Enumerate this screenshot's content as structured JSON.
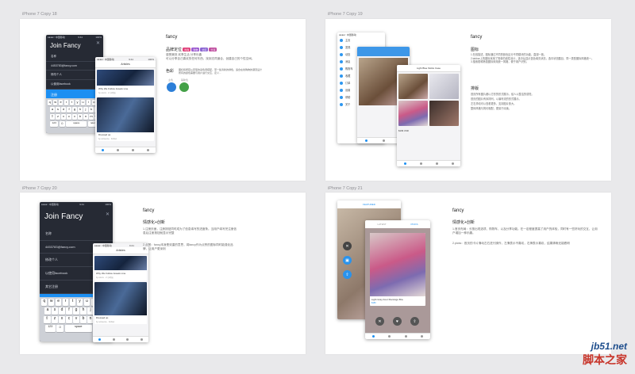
{
  "artboards": [
    {
      "title": "iPhone 7 Copy 18"
    },
    {
      "title": "iPhone 7 Copy 19"
    },
    {
      "title": "iPhone 7 Copy 20"
    },
    {
      "title": "iPhone 7 Copy 21"
    }
  ],
  "phone_status": {
    "carrier": "●●●●○ 中国移动",
    "time": "9:41",
    "battery": "100%"
  },
  "join_fancy": {
    "title": "Join Fancy",
    "row1": "名称",
    "row2": "4453783@fancy.com",
    "row3": "修改个人",
    "row4": "以使用facebook",
    "row5": "其它注册",
    "blue_bar": "注册"
  },
  "keyboard": {
    "row1": [
      "q",
      "w",
      "e",
      "r",
      "t",
      "y",
      "u",
      "i",
      "o",
      "p"
    ],
    "row2": [
      "a",
      "s",
      "d",
      "f",
      "g",
      "h",
      "j",
      "k",
      "l"
    ],
    "row3": [
      "⇧",
      "z",
      "x",
      "c",
      "v",
      "b",
      "n",
      "m",
      "⌫"
    ],
    "row4": [
      "123",
      "☺",
      "space",
      "return"
    ]
  },
  "articles": {
    "header": "Articles",
    "card1_title": "Why We Follow Jewels Line",
    "card1_sub": "by ooxxx · 2 小时前",
    "card2_title": "Dressed up",
    "card2_sub": "by someone · Follow"
  },
  "section1": {
    "heading": "fancy",
    "brand_label": "品牌定位",
    "tags": [
      "时尚",
      "购物",
      "社区",
      "分享"
    ],
    "brand_text": "感受潮流 欢享生活 分享乐趣\n可以分享自己喜欢的任何东西，找到志同道合，创建自己的个性空间。",
    "color_label": "色彩",
    "color_text": "图标和按钮从原型的蓝色调搭配，带一些清新的绿色，适合在线购物的潮流设计\n所有的颜色需要与用户进行交互、定义...",
    "swatch1_label": "主色",
    "swatch2_label": "辅助色",
    "swatch1": "#2c7fd8",
    "swatch2": "#43a047"
  },
  "section2": {
    "heading": "fancy",
    "icon_title": "图标",
    "icon_text1": "1.在线描述，图标通过不同的颜色区分不同模块的功能，直观一致。",
    "icon_text2": "2.tabbar上的图标采用了简单的线性设计，选中后显示蓝色填充状态，选中状态醒目，同一类型图标风格统一。",
    "icon_text3": "3.搜索框和筛选图标采用统一风格，便于用户识别。",
    "layout_title": "排版",
    "layout_text1": "首页所有图片都以方形的形式展示，给人以整洁的感觉。",
    "layout_text2": "首页的图片有序排列，以瀑布流的形式展示。",
    "layout_text3": "左右滑动可以查看更多，支持图片放大。",
    "layout_text4": "整体风格与简约相配，更易于阅读。",
    "menu_items": [
      "主页",
      "发现",
      "动态",
      "消息",
      "购物车",
      "收藏",
      "订单",
      "设置",
      "帮助",
      "关于"
    ],
    "tile_caption": "Light Blue Sticks Case",
    "price_tag": "$109 USD"
  },
  "section3": {
    "heading": "fancy",
    "title": "情感化+创新",
    "text1": "1.注册页面，注册按钮同时成为了信息填写的进度条。当用户填写完注册信息后注册按钮就显示完整",
    "text2": "2.点赞：fancy本身是双重的意思，将fancy作为点赞的图标同时能强化品牌，让用户更深刻"
  },
  "section4": {
    "heading": "fancy",
    "title": "情感化+创新",
    "text1": "1.首页布局：长按出现选项、购物车、以及分享功能。在一定程度提高了用户的体验，同时有一些好玩的交互，让用户增加一种乐趣。",
    "text2": "2.picks：首页的卡片滑动左右进行操作，左滑表示不喜欢，右滑表示喜欢，结果清晰还能看明",
    "tab_featured": "FEATURED",
    "tab_latest": "LATEST",
    "tab_picks": "PICKS",
    "product_title": "Light Gray Four Flamingo Bra",
    "price": "$189"
  },
  "watermark": {
    "line1": "jb51.net",
    "line2": "脚本之家"
  }
}
